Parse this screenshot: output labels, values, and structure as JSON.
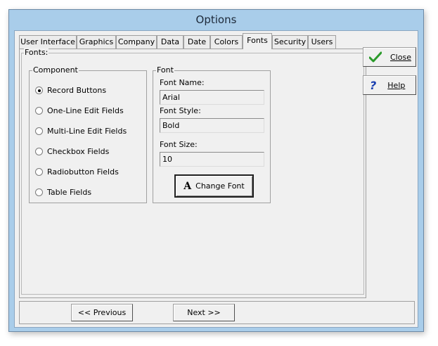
{
  "window": {
    "title": "Options"
  },
  "tabs": [
    {
      "label": "User Interface",
      "active": false
    },
    {
      "label": "Graphics",
      "active": false
    },
    {
      "label": "Company",
      "active": false
    },
    {
      "label": "Data",
      "active": false
    },
    {
      "label": "Date",
      "active": false
    },
    {
      "label": "Colors",
      "active": false
    },
    {
      "label": "Fonts",
      "active": true
    },
    {
      "label": "Security",
      "active": false
    },
    {
      "label": "Users",
      "active": false
    }
  ],
  "panel": {
    "fonts_legend": "Fonts:",
    "component": {
      "legend": "Component",
      "options": [
        {
          "label": "Record Buttons",
          "checked": true
        },
        {
          "label": "One-Line Edit Fields",
          "checked": false
        },
        {
          "label": "Multi-Line Edit Fields",
          "checked": false
        },
        {
          "label": "Checkbox Fields",
          "checked": false
        },
        {
          "label": "Radiobutton Fields",
          "checked": false
        },
        {
          "label": "Table Fields",
          "checked": false
        }
      ]
    },
    "font": {
      "legend": "Font",
      "name_label": "Font Name:",
      "name_value": "Arial",
      "style_label": "Font Style:",
      "style_value": "Bold",
      "size_label": "Font Size:",
      "size_value": "10",
      "change_button_icon": "A",
      "change_button_label": "Change Font"
    }
  },
  "side_buttons": {
    "close_label": "Close",
    "help_label": "Help"
  },
  "nav": {
    "previous_label": "<< Previous",
    "next_label": "Next >>"
  },
  "colors": {
    "check_green": "#2a9a2a",
    "help_blue": "#1a3fb0"
  }
}
